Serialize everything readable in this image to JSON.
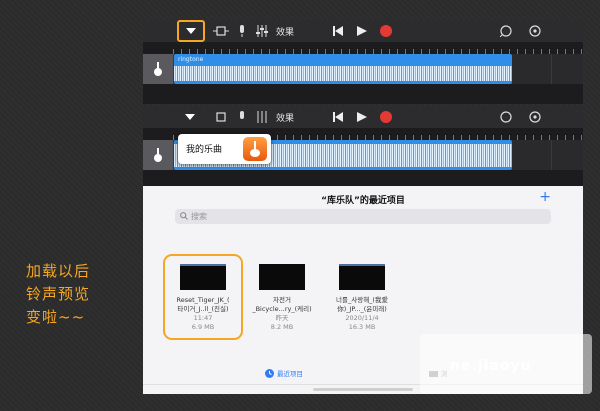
{
  "toolbar": {
    "effects_label": "效果"
  },
  "track": {
    "region_name": "ringtone"
  },
  "popup": {
    "label": "我的乐曲"
  },
  "browser": {
    "title": "“库乐队”的最近项目",
    "search_placeholder": "搜索",
    "add_label": "+",
    "files": [
      {
        "name_line1": "Reset_Tiger_JK_(",
        "name_line2": "타이거_J..ll_(진실)",
        "date": "11:47",
        "size": "6.9 MB",
        "highlighted": true
      },
      {
        "name_line1": "자전거",
        "name_line2": "_Bicycle...ry_(케리)",
        "date": "昨天",
        "size": "8.2 MB",
        "highlighted": false
      },
      {
        "name_line1": "너를_사랑해_(我爱",
        "name_line2": "你)_JP..._(윤미래)",
        "date": "2020/11/4",
        "size": "16.3 MB",
        "highlighted": false
      }
    ],
    "bottom_tab": "最近项目",
    "bottom_tab_right": "浏"
  },
  "annotation": {
    "line1": "加载以后",
    "line2": "铃声预览",
    "line3": "变啦~~"
  },
  "watermark": "ne.jiaoyu",
  "colors": {
    "accent": "#f5a623",
    "region_blue": "#2f8ee8",
    "record_red": "#e53935"
  }
}
